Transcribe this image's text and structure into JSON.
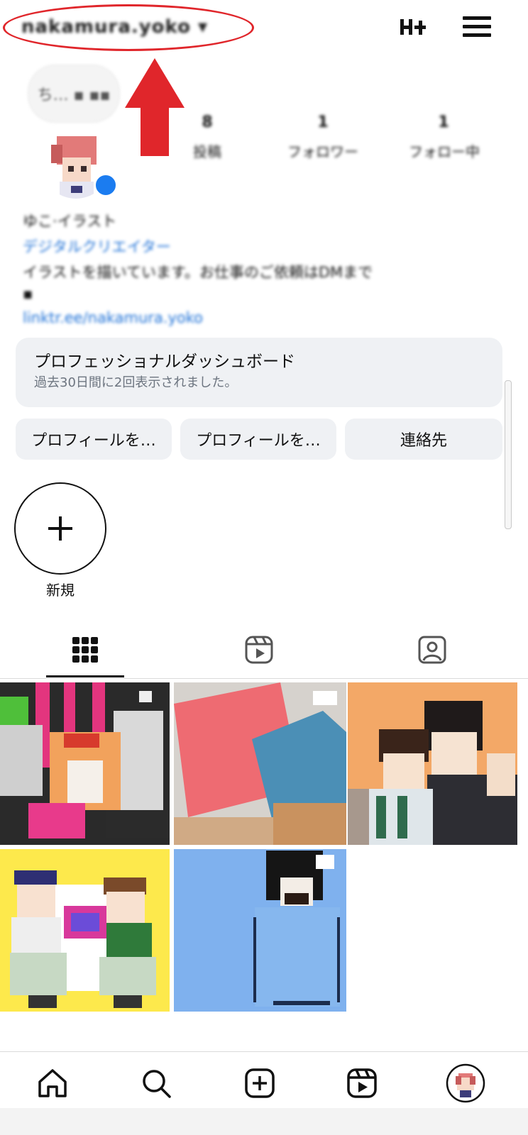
{
  "header": {
    "username": "nakamura.yoko ▾",
    "threads_icon": "threads-icon",
    "menu_icon": "hamburger-menu-icon"
  },
  "annotation": {
    "color": "#e0262b"
  },
  "profile": {
    "note": "ち… ▪ ▪▪",
    "stats": [
      {
        "value": "8",
        "label": "投稿"
      },
      {
        "value": "1",
        "label": "フォロワー"
      },
      {
        "value": "1",
        "label": "フォロー中"
      }
    ],
    "bio_lines": [
      {
        "text": "ゆこ·イラスト",
        "style": "dark"
      },
      {
        "text": "デジタルクリエイター",
        "style": "blue"
      },
      {
        "text": "イラストを描いています。お仕事のご依頼はDMまで",
        "style": "dark"
      },
      {
        "text": "▪",
        "style": "dark"
      },
      {
        "text": "linktr.ee/nakamura.yoko",
        "style": "blue"
      }
    ]
  },
  "dashboard": {
    "title": "プロフェッショナルダッシュボード",
    "subtitle": "過去30日間に2回表示されました。"
  },
  "buttons": [
    {
      "label": "プロフィールを…"
    },
    {
      "label": "プロフィールを…"
    },
    {
      "label": "連絡先"
    }
  ],
  "highlights": {
    "new_label": "新規"
  },
  "tabs": [
    "grid-icon",
    "reels-icon",
    "tagged-icon"
  ],
  "posts": [
    {
      "name": "post-1"
    },
    {
      "name": "post-2"
    },
    {
      "name": "post-3"
    },
    {
      "name": "post-4"
    },
    {
      "name": "post-5"
    }
  ],
  "bottom_nav": [
    "home-icon",
    "search-icon",
    "create-icon",
    "reels-icon",
    "profile-avatar"
  ],
  "colors": {
    "link_blue": "#1b6fd6",
    "badge_blue": "#1b7cf0",
    "annotation_red": "#e0262b"
  }
}
